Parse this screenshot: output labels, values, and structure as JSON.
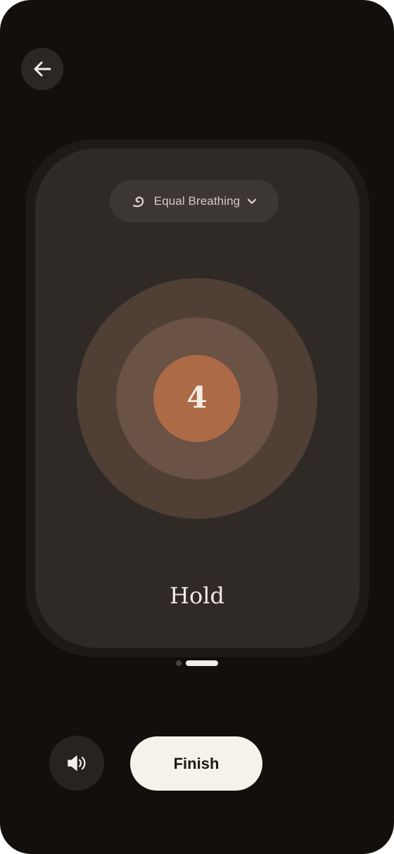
{
  "header": {
    "back_icon": "arrow-left-icon"
  },
  "pattern_selector": {
    "icon": "breath-swirl-icon",
    "label": "Equal Breathing",
    "dropdown_icon": "chevron-down-icon"
  },
  "breathing": {
    "count": "4",
    "phase": "Hold"
  },
  "pager": {
    "pages": 2,
    "active_index": 1
  },
  "controls": {
    "sound_icon": "speaker-volume-icon",
    "finish_label": "Finish"
  },
  "colors": {
    "background": "#120f0d",
    "card": "#2f2a26",
    "ring_outer": "#4f3f35",
    "ring_middle": "#6a5244",
    "ring_core": "#ac6a46",
    "finish_button": "#f7f2e9"
  }
}
